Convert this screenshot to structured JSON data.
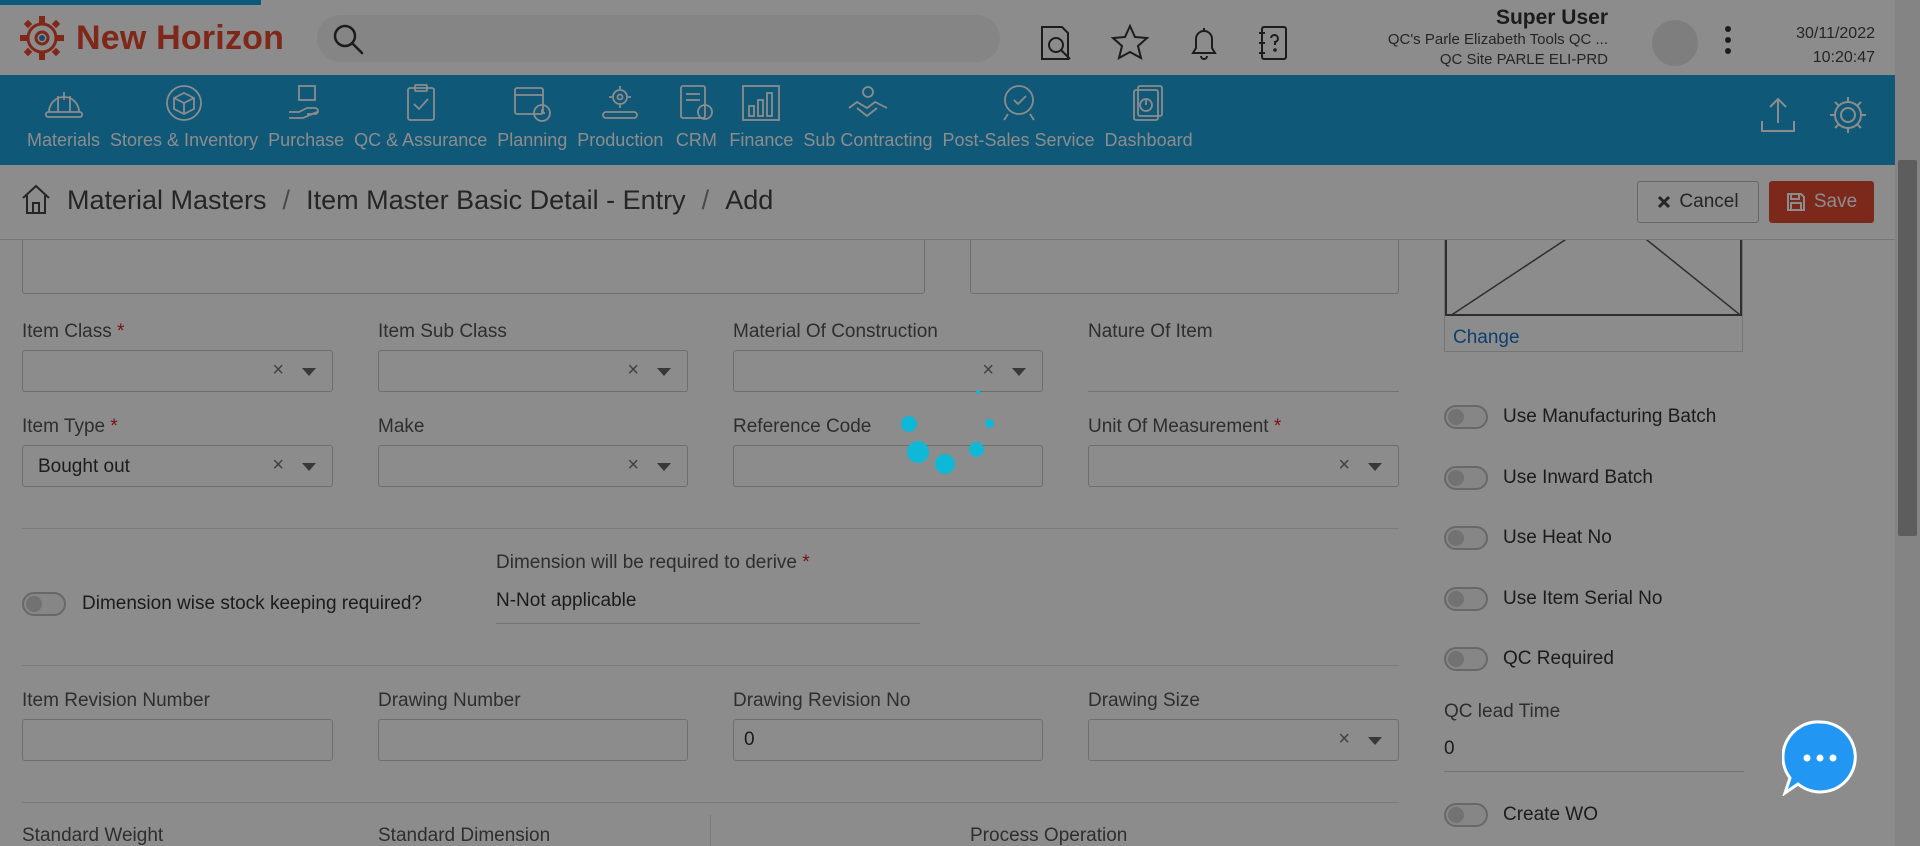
{
  "app": {
    "title": "New Horizon"
  },
  "search": {
    "placeholder": ""
  },
  "user": {
    "name": "Super User",
    "company": "QC's Parle Elizabeth Tools QC ...",
    "site": "QC Site PARLE ELI-PRD"
  },
  "datetime": {
    "date": "30/11/2022",
    "time": "10:20:47"
  },
  "top_icons": [
    "document-search-icon",
    "star-icon",
    "bell-icon",
    "help-book-icon"
  ],
  "nav": {
    "items": [
      {
        "label": "Materials",
        "icon": "helmet-icon"
      },
      {
        "label": "Stores & Inventory",
        "icon": "box-icon"
      },
      {
        "label": "Purchase",
        "icon": "hand-package-icon"
      },
      {
        "label": "QC & Assurance",
        "icon": "clipboard-check-icon"
      },
      {
        "label": "Planning",
        "icon": "calendar-clock-icon"
      },
      {
        "label": "Production",
        "icon": "gear-conveyor-icon"
      },
      {
        "label": "CRM",
        "icon": "crm-icon"
      },
      {
        "label": "Finance",
        "icon": "bar-chart-icon"
      },
      {
        "label": "Sub Contracting",
        "icon": "handshake-icon"
      },
      {
        "label": "Post-Sales Service",
        "icon": "service-icon"
      },
      {
        "label": "Dashboard",
        "icon": "dashboard-icon"
      }
    ]
  },
  "breadcrumb": {
    "items": [
      "Material Masters",
      "Item Master Basic Detail - Entry",
      "Add"
    ],
    "separator": "/"
  },
  "actions": {
    "cancel_label": "Cancel",
    "save_label": "Save",
    "save_color": "#e24a32"
  },
  "form": {
    "item_class": {
      "label": "Item Class",
      "value": ""
    },
    "item_sub_class": {
      "label": "Item Sub Class",
      "value": ""
    },
    "material_of_construction": {
      "label": "Material Of Construction",
      "value": ""
    },
    "nature_of_item": {
      "label": "Nature Of Item",
      "value": ""
    },
    "item_type": {
      "label": "Item Type",
      "value": "Bought out"
    },
    "make": {
      "label": "Make",
      "value": ""
    },
    "reference_code": {
      "label": "Reference Code",
      "value": ""
    },
    "unit_of_measurement": {
      "label": "Unit Of Measurement",
      "value": ""
    },
    "dimension_stock": {
      "label": "Dimension wise stock keeping required?"
    },
    "dimension_derive": {
      "label": "Dimension will be required to derive",
      "value": "N-Not applicable"
    },
    "item_revision_number": {
      "label": "Item Revision Number",
      "value": ""
    },
    "drawing_number": {
      "label": "Drawing Number",
      "value": ""
    },
    "drawing_revision_no": {
      "label": "Drawing Revision No",
      "value": "0"
    },
    "drawing_size": {
      "label": "Drawing Size",
      "value": ""
    },
    "standard_weight": {
      "label": "Standard Weight"
    },
    "standard_dimension": {
      "label": "Standard Dimension"
    },
    "process_operation": {
      "label": "Process Operation"
    },
    "required_mark": "*",
    "clear_symbol": "×"
  },
  "side": {
    "change_label": "Change",
    "toggles": [
      {
        "label": "Use Manufacturing Batch"
      },
      {
        "label": "Use Inward Batch"
      },
      {
        "label": "Use Heat No"
      },
      {
        "label": "Use Item Serial No"
      },
      {
        "label": "QC Required"
      }
    ],
    "qc_lead_time": {
      "label": "QC lead Time",
      "value": "0"
    },
    "create_wo": {
      "label": "Create WO"
    }
  },
  "colors": {
    "brand": "#e84a2f",
    "nav_bg": "#1da1d9",
    "spinner": "#0fb8d6",
    "chat": "#2196f3",
    "overlay": "rgba(0,0,0,0.45)"
  }
}
